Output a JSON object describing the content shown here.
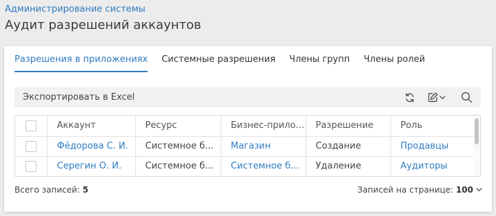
{
  "breadcrumb": "Администрирование системы",
  "page_title": "Аудит разрешений аккаунтов",
  "tabs": [
    {
      "label": "Разрешения в приложениях",
      "active": true
    },
    {
      "label": "Системные разрешения",
      "active": false
    },
    {
      "label": "Члены групп",
      "active": false
    },
    {
      "label": "Члены ролей",
      "active": false
    }
  ],
  "toolbar": {
    "export_label": "Экспортировать в Excel",
    "icons": [
      "refresh-icon",
      "edit-icon",
      "chevron-down-icon",
      "search-icon"
    ]
  },
  "table": {
    "columns": [
      "Аккаунт",
      "Ресурс",
      "Бизнес-приложение",
      "Разрешение",
      "Роль"
    ],
    "rows": [
      {
        "account": "Фёдорова С. И.",
        "resource": "Системное б...",
        "app": "Магазин",
        "permission": "Создание",
        "role": "Продавцы"
      },
      {
        "account": "Серегин О. И.",
        "resource": "Системное б...",
        "app": "Системное б...",
        "permission": "Удаление",
        "role": "Аудиторы"
      }
    ]
  },
  "footer": {
    "total_label": "Всего записей:",
    "total_value": "5",
    "per_page_label": "Записей на странице:",
    "per_page_value": "100"
  },
  "colors": {
    "accent": "#2e7bc1",
    "background": "#ececec",
    "toolbar": "#f1f1f1"
  }
}
